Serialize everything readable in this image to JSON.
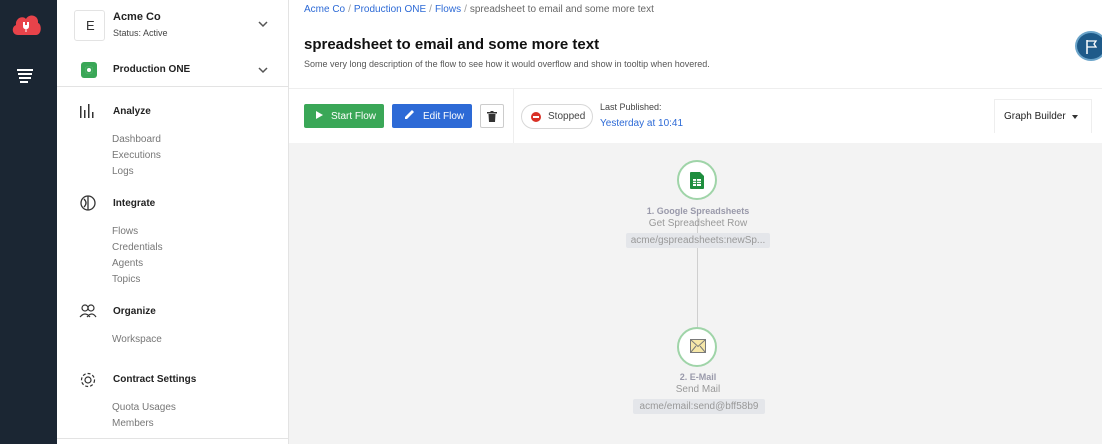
{
  "org": {
    "name": "Acme Co",
    "status": "Status: Active",
    "icon_letter": "E"
  },
  "environment": {
    "name": "Production ONE"
  },
  "sidebar": {
    "analyze": {
      "title": "Analyze",
      "items": [
        "Dashboard",
        "Executions",
        "Logs"
      ]
    },
    "integrate": {
      "title": "Integrate",
      "items": [
        "Flows",
        "Credentials",
        "Agents",
        "Topics"
      ]
    },
    "organize": {
      "title": "Organize",
      "items": [
        "Workspace"
      ]
    },
    "contract": {
      "title": "Contract Settings",
      "items": [
        "Quota Usages",
        "Members"
      ]
    }
  },
  "breadcrumb": [
    "Acme Co",
    "Production ONE",
    "Flows",
    "spreadsheet to email and some more text"
  ],
  "flow": {
    "title": "spreadsheet to email and some more text",
    "description": "Some very long description of the flow to see how it would overflow and show in tooltip when hovered."
  },
  "toolbar": {
    "start_label": "Start Flow",
    "edit_label": "Edit Flow",
    "status": "Stopped",
    "published_label": "Last Published:",
    "published_value": "Yesterday at 10:41",
    "view_mode": "Graph Builder"
  },
  "colors": {
    "rail": "#1b2633",
    "accent": "#2d6ad6",
    "success": "#3aa757",
    "danger": "#d93025",
    "logo": "#e8434a"
  },
  "nodes": [
    {
      "title": "1. Google Spreadsheets",
      "subtitle": "Get Spreadsheet Row",
      "component": "acme/gspreadsheets:newSp...",
      "icon": "spreadsheet-icon"
    },
    {
      "title": "2. E-Mail",
      "subtitle": "Send Mail",
      "component": "acme/email:send@bff58b9",
      "icon": "email-icon"
    }
  ]
}
